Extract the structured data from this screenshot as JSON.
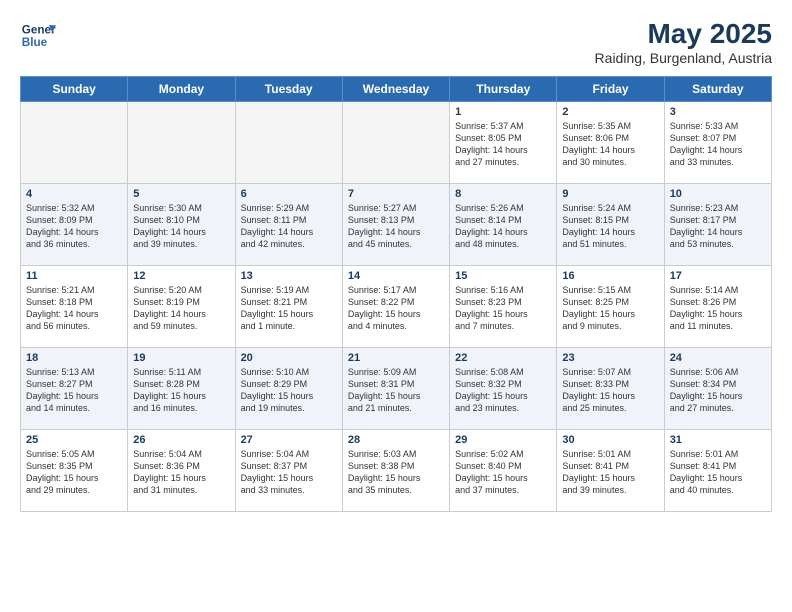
{
  "logo": {
    "line1": "General",
    "line2": "Blue"
  },
  "title": "May 2025",
  "location": "Raiding, Burgenland, Austria",
  "days_of_week": [
    "Sunday",
    "Monday",
    "Tuesday",
    "Wednesday",
    "Thursday",
    "Friday",
    "Saturday"
  ],
  "weeks": [
    [
      {
        "day": "",
        "text": ""
      },
      {
        "day": "",
        "text": ""
      },
      {
        "day": "",
        "text": ""
      },
      {
        "day": "",
        "text": ""
      },
      {
        "day": "1",
        "text": "Sunrise: 5:37 AM\nSunset: 8:05 PM\nDaylight: 14 hours\nand 27 minutes."
      },
      {
        "day": "2",
        "text": "Sunrise: 5:35 AM\nSunset: 8:06 PM\nDaylight: 14 hours\nand 30 minutes."
      },
      {
        "day": "3",
        "text": "Sunrise: 5:33 AM\nSunset: 8:07 PM\nDaylight: 14 hours\nand 33 minutes."
      }
    ],
    [
      {
        "day": "4",
        "text": "Sunrise: 5:32 AM\nSunset: 8:09 PM\nDaylight: 14 hours\nand 36 minutes."
      },
      {
        "day": "5",
        "text": "Sunrise: 5:30 AM\nSunset: 8:10 PM\nDaylight: 14 hours\nand 39 minutes."
      },
      {
        "day": "6",
        "text": "Sunrise: 5:29 AM\nSunset: 8:11 PM\nDaylight: 14 hours\nand 42 minutes."
      },
      {
        "day": "7",
        "text": "Sunrise: 5:27 AM\nSunset: 8:13 PM\nDaylight: 14 hours\nand 45 minutes."
      },
      {
        "day": "8",
        "text": "Sunrise: 5:26 AM\nSunset: 8:14 PM\nDaylight: 14 hours\nand 48 minutes."
      },
      {
        "day": "9",
        "text": "Sunrise: 5:24 AM\nSunset: 8:15 PM\nDaylight: 14 hours\nand 51 minutes."
      },
      {
        "day": "10",
        "text": "Sunrise: 5:23 AM\nSunset: 8:17 PM\nDaylight: 14 hours\nand 53 minutes."
      }
    ],
    [
      {
        "day": "11",
        "text": "Sunrise: 5:21 AM\nSunset: 8:18 PM\nDaylight: 14 hours\nand 56 minutes."
      },
      {
        "day": "12",
        "text": "Sunrise: 5:20 AM\nSunset: 8:19 PM\nDaylight: 14 hours\nand 59 minutes."
      },
      {
        "day": "13",
        "text": "Sunrise: 5:19 AM\nSunset: 8:21 PM\nDaylight: 15 hours\nand 1 minute."
      },
      {
        "day": "14",
        "text": "Sunrise: 5:17 AM\nSunset: 8:22 PM\nDaylight: 15 hours\nand 4 minutes."
      },
      {
        "day": "15",
        "text": "Sunrise: 5:16 AM\nSunset: 8:23 PM\nDaylight: 15 hours\nand 7 minutes."
      },
      {
        "day": "16",
        "text": "Sunrise: 5:15 AM\nSunset: 8:25 PM\nDaylight: 15 hours\nand 9 minutes."
      },
      {
        "day": "17",
        "text": "Sunrise: 5:14 AM\nSunset: 8:26 PM\nDaylight: 15 hours\nand 11 minutes."
      }
    ],
    [
      {
        "day": "18",
        "text": "Sunrise: 5:13 AM\nSunset: 8:27 PM\nDaylight: 15 hours\nand 14 minutes."
      },
      {
        "day": "19",
        "text": "Sunrise: 5:11 AM\nSunset: 8:28 PM\nDaylight: 15 hours\nand 16 minutes."
      },
      {
        "day": "20",
        "text": "Sunrise: 5:10 AM\nSunset: 8:29 PM\nDaylight: 15 hours\nand 19 minutes."
      },
      {
        "day": "21",
        "text": "Sunrise: 5:09 AM\nSunset: 8:31 PM\nDaylight: 15 hours\nand 21 minutes."
      },
      {
        "day": "22",
        "text": "Sunrise: 5:08 AM\nSunset: 8:32 PM\nDaylight: 15 hours\nand 23 minutes."
      },
      {
        "day": "23",
        "text": "Sunrise: 5:07 AM\nSunset: 8:33 PM\nDaylight: 15 hours\nand 25 minutes."
      },
      {
        "day": "24",
        "text": "Sunrise: 5:06 AM\nSunset: 8:34 PM\nDaylight: 15 hours\nand 27 minutes."
      }
    ],
    [
      {
        "day": "25",
        "text": "Sunrise: 5:05 AM\nSunset: 8:35 PM\nDaylight: 15 hours\nand 29 minutes."
      },
      {
        "day": "26",
        "text": "Sunrise: 5:04 AM\nSunset: 8:36 PM\nDaylight: 15 hours\nand 31 minutes."
      },
      {
        "day": "27",
        "text": "Sunrise: 5:04 AM\nSunset: 8:37 PM\nDaylight: 15 hours\nand 33 minutes."
      },
      {
        "day": "28",
        "text": "Sunrise: 5:03 AM\nSunset: 8:38 PM\nDaylight: 15 hours\nand 35 minutes."
      },
      {
        "day": "29",
        "text": "Sunrise: 5:02 AM\nSunset: 8:40 PM\nDaylight: 15 hours\nand 37 minutes."
      },
      {
        "day": "30",
        "text": "Sunrise: 5:01 AM\nSunset: 8:41 PM\nDaylight: 15 hours\nand 39 minutes."
      },
      {
        "day": "31",
        "text": "Sunrise: 5:01 AM\nSunset: 8:41 PM\nDaylight: 15 hours\nand 40 minutes."
      }
    ]
  ]
}
